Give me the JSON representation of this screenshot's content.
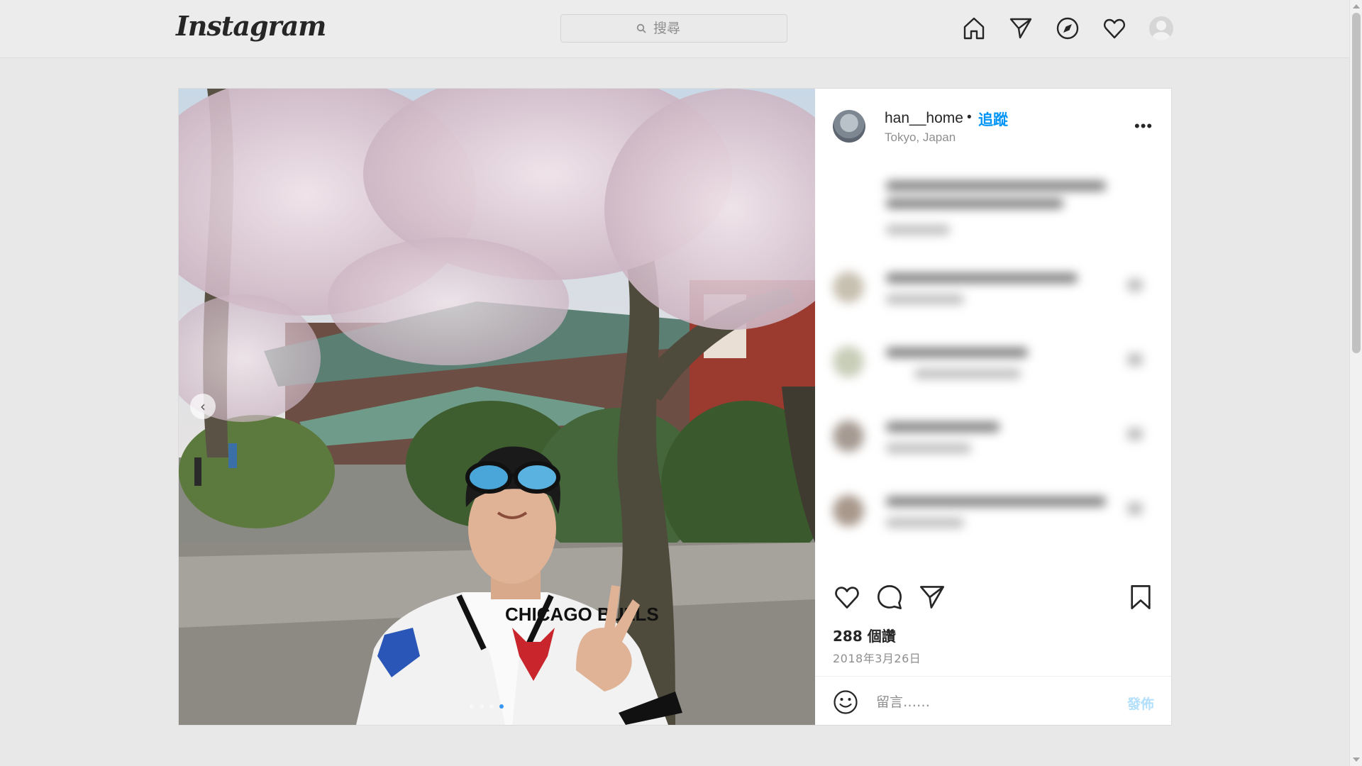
{
  "nav": {
    "logo": "Instagram",
    "search_placeholder": "搜尋",
    "icons": [
      "home-icon",
      "direct-icon",
      "explore-icon",
      "activity-heart-icon",
      "profile-avatar"
    ]
  },
  "post": {
    "username": "han__home",
    "separator": "•",
    "follow_label": "追蹤",
    "location": "Tokyo, Japan",
    "more_label": "•••",
    "likes": "288 個讚",
    "date": "2018年3月26日",
    "comment_placeholder": "留言……",
    "post_button": "發佈",
    "carousel_prev": "‹",
    "jacket_text": "CHICAGO BULLS"
  },
  "colors": {
    "link_blue": "#0095f6",
    "post_button_disabled": "#b2dffc",
    "page_background": "#e8e8e8"
  }
}
